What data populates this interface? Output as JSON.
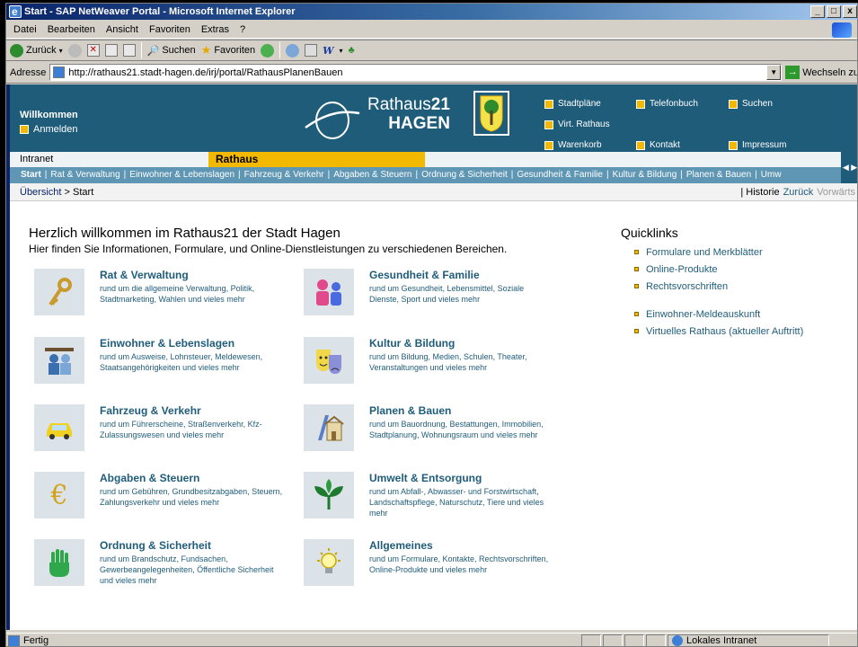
{
  "window": {
    "title": "Start - SAP NetWeaver Portal - Microsoft Internet Explorer",
    "controls": [
      "_",
      "□",
      "x"
    ]
  },
  "menu": [
    "Datei",
    "Bearbeiten",
    "Ansicht",
    "Favoriten",
    "Extras",
    "?"
  ],
  "toolbar": {
    "back": "Zurück",
    "search": "Suchen",
    "favorites": "Favoriten"
  },
  "address": {
    "label": "Adresse",
    "url": "http://rathaus21.stadt-hagen.de/irj/portal/RathausPlanenBauen",
    "go": "Wechseln zu"
  },
  "header": {
    "welcome": "Willkommen",
    "login": "Anmelden",
    "logo_word": "Rathaus",
    "logo_num": "21",
    "logo_city": "HAGEN",
    "links": [
      {
        "label": "Stadtpläne"
      },
      {
        "label": "Telefonbuch"
      },
      {
        "label": "Suchen"
      },
      {
        "label": "Virt. Rathaus"
      },
      {
        "label": "Warenkorb"
      },
      {
        "label": "Kontakt"
      },
      {
        "label": "Impressum"
      }
    ]
  },
  "tabs": {
    "intranet": "Intranet",
    "rathaus": "Rathaus"
  },
  "subnav": [
    "Start",
    "Rat & Verwaltung",
    "Einwohner & Lebenslagen",
    "Fahrzeug & Verkehr",
    "Abgaben & Steuern",
    "Ordnung & Sicherheit",
    "Gesundheit & Familie",
    "Kultur & Bildung",
    "Planen & Bauen",
    "Umw"
  ],
  "breadcrumb": {
    "overview": "Übersicht",
    "sep": ">",
    "current": "Start",
    "history": "| Historie",
    "back": "Zurück",
    "forward": "Vorwärts"
  },
  "main": {
    "heading": "Herzlich willkommen im Rathaus21 der Stadt Hagen",
    "subheading": "Hier finden Sie Informationen, Formulare, und Online-Dienstleistungen zu verschiedenen Bereichen."
  },
  "categories": [
    {
      "title": "Rat & Verwaltung",
      "desc": "rund um die allgemeine Verwaltung, Politik, Stadtmarketing, Wahlen und vieles mehr",
      "icon": "key-icon"
    },
    {
      "title": "Gesundheit & Familie",
      "desc": "rund um Gesundheit, Lebensmittel, Soziale Dienste, Sport und vieles mehr",
      "icon": "family-icon"
    },
    {
      "title": "Einwohner & Lebenslagen",
      "desc": "rund um Ausweise, Lohnsteuer, Meldewesen, Staatsangehörigkeiten und vieles mehr",
      "icon": "residents-icon"
    },
    {
      "title": "Kultur & Bildung",
      "desc": "rund um Bildung, Medien, Schulen, Theater, Veranstaltungen und vieles mehr",
      "icon": "theater-masks-icon"
    },
    {
      "title": "Fahrzeug & Verkehr",
      "desc": "rund um Führerscheine, Straßenverkehr, Kfz-Zulassungswesen und vieles mehr",
      "icon": "car-icon"
    },
    {
      "title": "Planen & Bauen",
      "desc": "rund um Bauordnung, Bestattungen, Immobilien, Stadtplanung, Wohnungsraum und vieles mehr",
      "icon": "building-plan-icon"
    },
    {
      "title": "Abgaben & Steuern",
      "desc": "rund um Gebühren, Grundbesitzabgaben, Steuern, Zahlungsverkehr und vieles mehr",
      "icon": "euro-icon"
    },
    {
      "title": "Umwelt & Entsorgung",
      "desc": "rund um Abfall-, Abwasser- und Forstwirtschaft, Landschaftspflege, Naturschutz, Tiere und vieles mehr",
      "icon": "plant-icon"
    },
    {
      "title": "Ordnung & Sicherheit",
      "desc": "rund um Brandschutz, Fundsachen, Gewerbeangelegenheiten, Öffentliche Sicherheit und vieles mehr",
      "icon": "hand-icon"
    },
    {
      "title": "Allgemeines",
      "desc": "rund um Formulare, Kontakte, Rechtsvorschriften, Online-Produkte und vieles mehr",
      "icon": "lightbulb-icon"
    }
  ],
  "quicklinks": {
    "title": "Quicklinks",
    "group1": [
      "Formulare und Merkblätter",
      "Online-Produkte",
      "Rechtsvorschriften"
    ],
    "group2": [
      "Einwohner-Meldeauskunft",
      "Virtuelles Rathaus (aktueller Auftritt)"
    ]
  },
  "status": {
    "text": "Fertig",
    "zone": "Lokales Intranet"
  },
  "colors": {
    "portal_teal": "#1f5c7a",
    "accent_yellow": "#f3b800",
    "subnav_blue": "#5f96b3"
  }
}
